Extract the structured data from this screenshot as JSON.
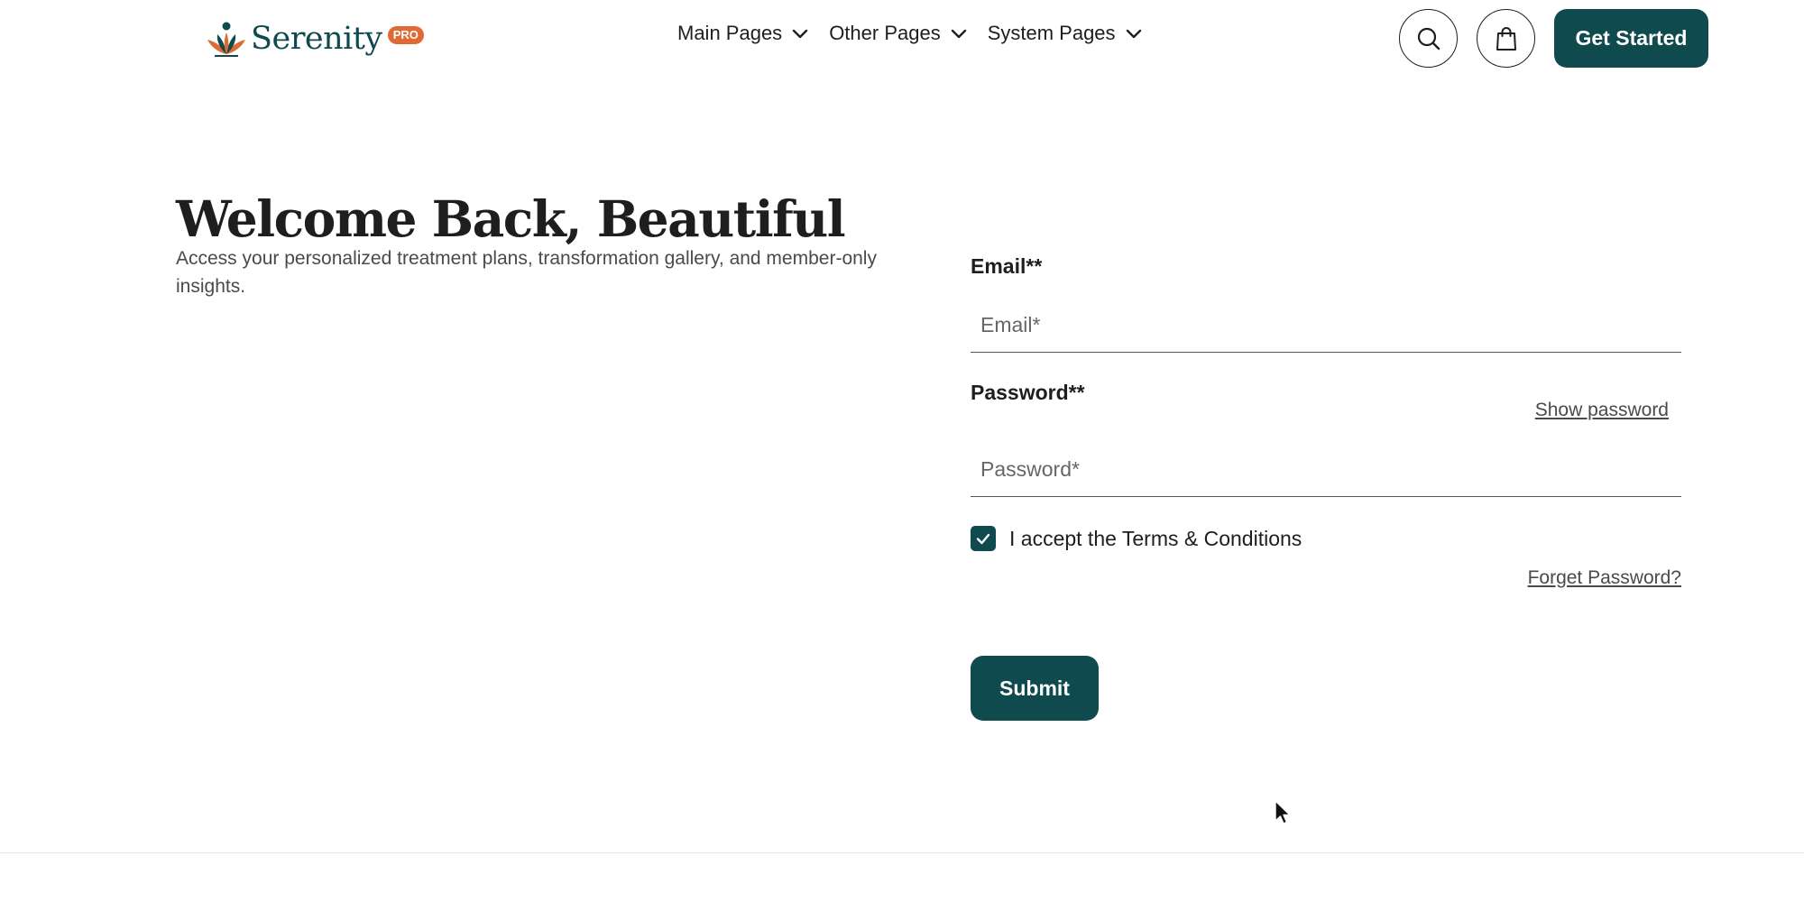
{
  "header": {
    "logo": {
      "name": "Serenity",
      "badge": "PRO",
      "icon": "lotus-figure-icon"
    },
    "nav": [
      {
        "label": "Main Pages",
        "icon": "chevron-down-icon"
      },
      {
        "label": "Other Pages",
        "icon": "chevron-down-icon"
      },
      {
        "label": "System Pages",
        "icon": "chevron-down-icon"
      }
    ],
    "search_icon": "search-icon",
    "cart_icon": "shopping-bag-icon",
    "cta_label": "Get Started"
  },
  "intro": {
    "title": "Welcome Back, Beautiful",
    "subtitle": "Access your personalized treatment plans, transformation gallery, and member-only insights."
  },
  "form": {
    "email_label": "Email**",
    "email_placeholder": "Email*",
    "email_value": "",
    "password_label": "Password**",
    "password_placeholder": "Password*",
    "password_value": "",
    "show_password": "Show password",
    "terms_label": "I accept the Terms & Conditions",
    "terms_checked": true,
    "forget_password": "Forget Password?",
    "submit_label": "Submit"
  },
  "colors": {
    "brand": "#0f4a4e",
    "badge": "#e06a34",
    "text": "#1e1e1e",
    "muted": "#4a4a4a"
  }
}
